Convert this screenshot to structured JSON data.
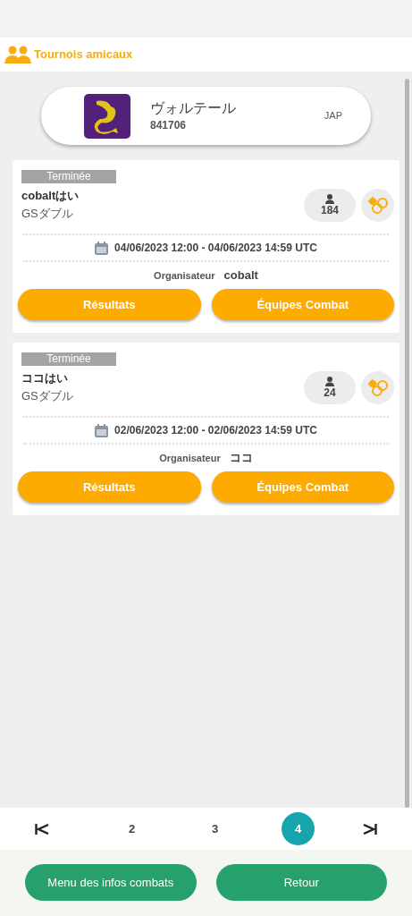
{
  "header": {
    "title": "Tournois amicaux"
  },
  "profile": {
    "name": "ヴォルテール",
    "id": "841706",
    "region": "JAP"
  },
  "tournaments": [
    {
      "status": "Terminée",
      "title": "cobaltはい",
      "format": "GSダブル",
      "players": "184",
      "dates": "04/06/2023 12:00 - 04/06/2023 14:59 UTC",
      "organizer_label": "Organisateur",
      "organizer": "cobalt",
      "buttons": [
        "Résultats",
        "Équipes Combat"
      ]
    },
    {
      "status": "Terminée",
      "title": "ココはい",
      "format": "GSダブル",
      "players": "24",
      "dates": "02/06/2023 12:00 - 02/06/2023 14:59 UTC",
      "organizer_label": "Organisateur",
      "organizer": "ココ",
      "buttons": [
        "Résultats",
        "Équipes Combat"
      ]
    }
  ],
  "pagination": {
    "pages": [
      {
        "label": "2",
        "selected": false
      },
      {
        "label": "3",
        "selected": false
      },
      {
        "label": "4",
        "selected": true
      }
    ]
  },
  "footer_buttons": [
    "Menu des infos combats",
    "Retour"
  ]
}
